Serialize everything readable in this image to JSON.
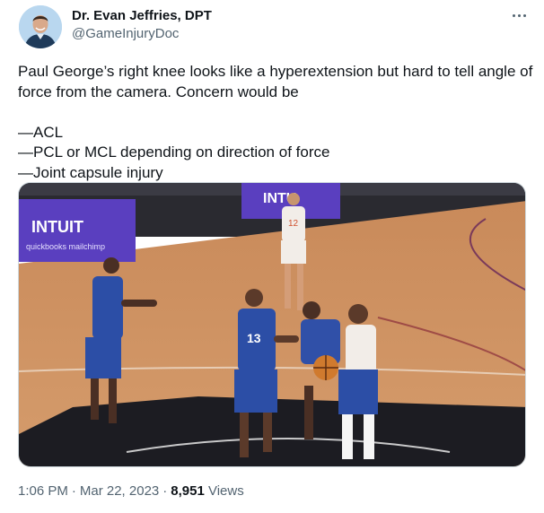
{
  "author": {
    "display_name": "Dr. Evan Jeffries, DPT",
    "handle": "@GameInjuryDoc"
  },
  "tweet": {
    "text": "Paul George’s right knee looks like a hyperextension but hard to tell angle of force from the camera. Concern would be\n\n—ACL\n—PCL or MCL depending on direction of force\n—Joint capsule injury"
  },
  "media": {
    "description_icon": "basketball-game-photo",
    "signage": {
      "sponsor": "INTUIT",
      "sub_sponsors": "quickbooks  mailchimp",
      "banner": "INTU"
    },
    "jerseys": {
      "left_defender": "",
      "center_player": "13",
      "background_player": "12"
    }
  },
  "meta": {
    "time": "1:06 PM",
    "date": "Mar 22, 2023",
    "views_count": "8,951",
    "views_label": "Views"
  },
  "colors": {
    "text_primary": "#0f1419",
    "text_secondary": "#536471",
    "border": "#cfd9de"
  }
}
